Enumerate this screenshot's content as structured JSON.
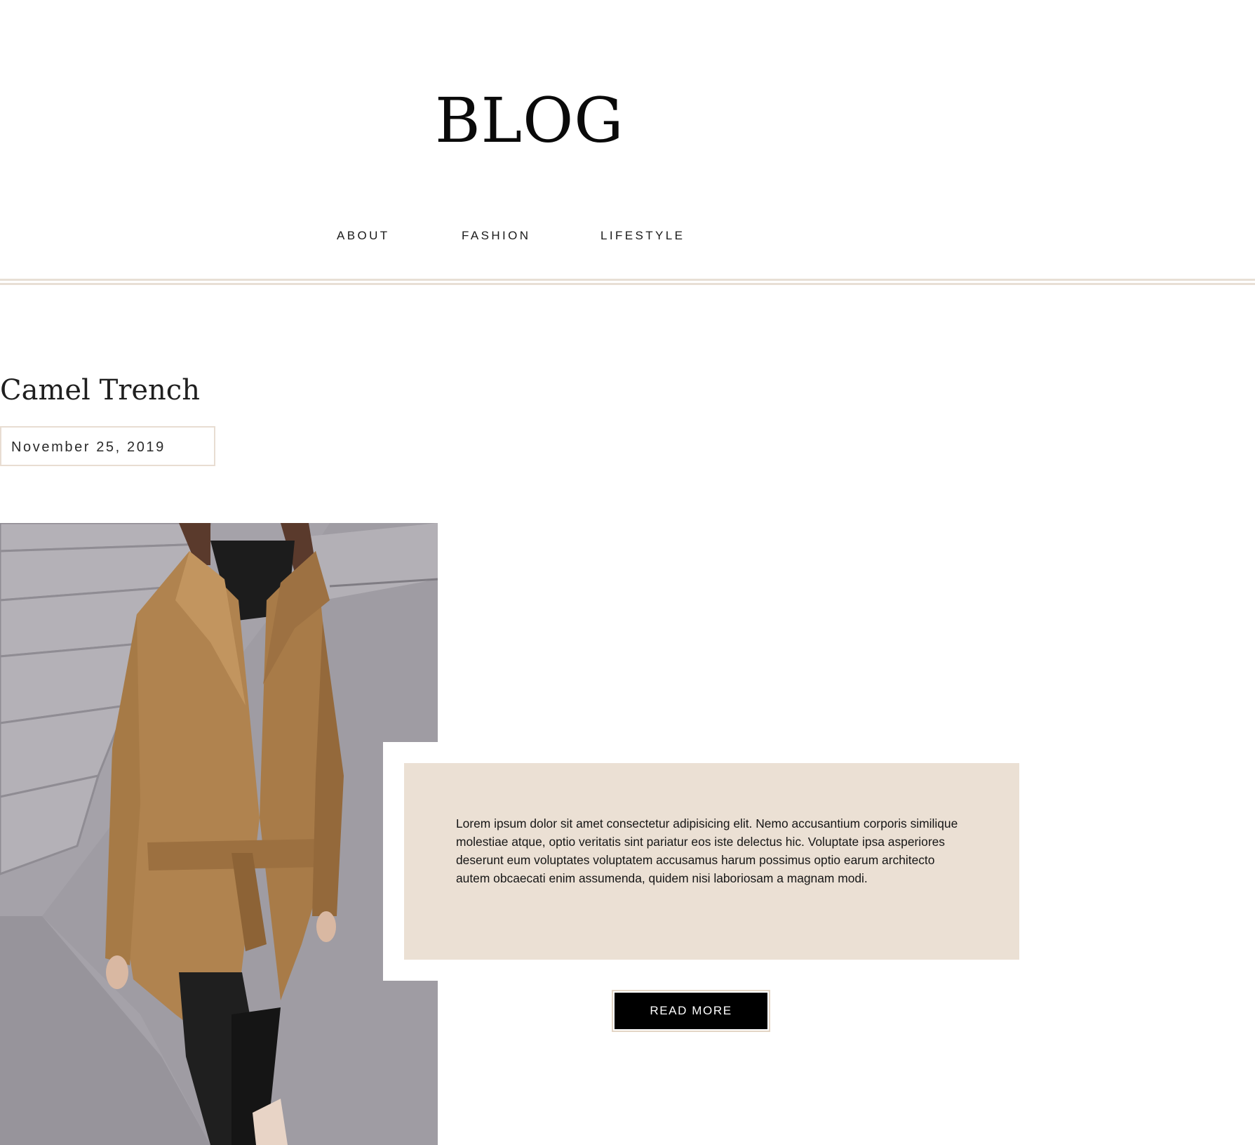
{
  "header": {
    "site_title": "BLOG"
  },
  "nav": {
    "items": [
      {
        "label": "ABOUT"
      },
      {
        "label": "FASHION"
      },
      {
        "label": "LIFESTYLE"
      }
    ]
  },
  "post": {
    "title": "Camel Trench",
    "date": "November 25, 2019",
    "image": {
      "subject": "woman-in-camel-trench-coat-on-stone-steps",
      "coat_color": "#b0834f",
      "background_color": "#a29fa6"
    },
    "excerpt": "Lorem ipsum dolor sit amet consectetur adipisicing elit. Nemo accusantium corporis similique molestiae atque, optio veritatis sint pariatur eos iste delectus hic. Voluptate ipsa asperiores deserunt eum voluptates voluptatem accusamus harum possimus optio earum architecto autem obcaecati enim assumenda, quidem nisi laboriosam a magnam modi.",
    "read_more_label": "READ MORE"
  },
  "colors": {
    "accent_beige": "#ebe0d4",
    "divider": "#e8dfd5",
    "button_bg": "#000000",
    "text": "#111111"
  }
}
